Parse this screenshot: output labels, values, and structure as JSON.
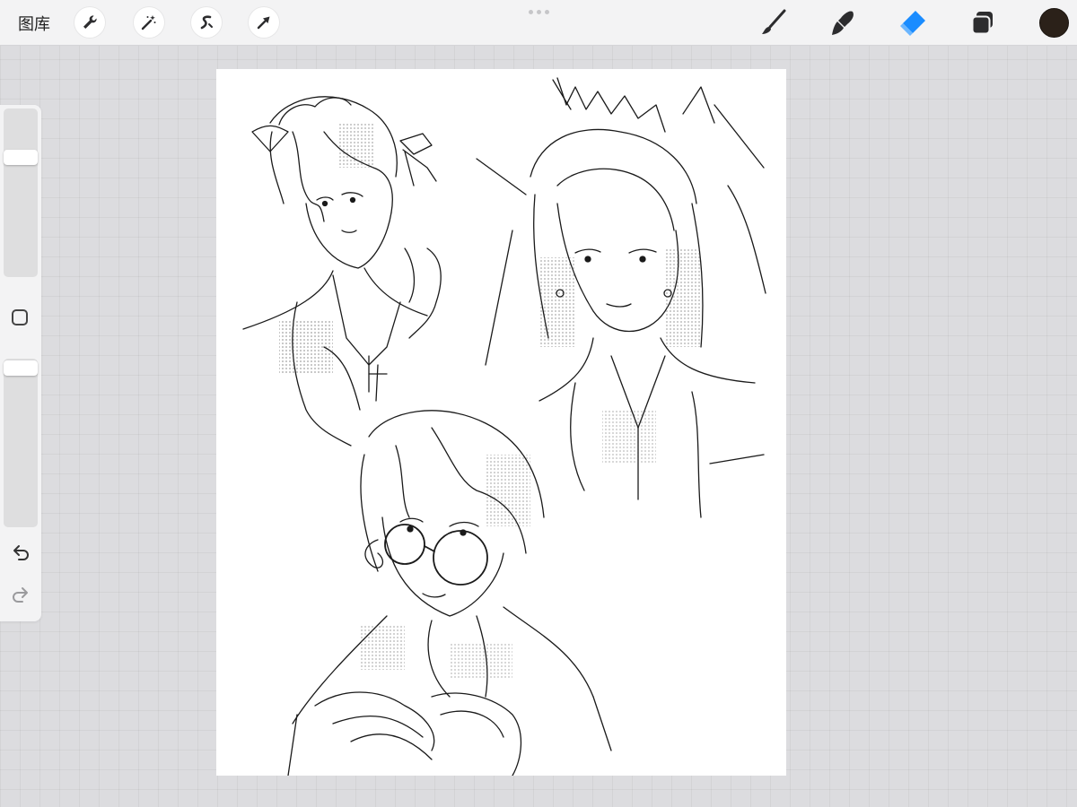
{
  "topbar": {
    "gallery_label": "图库",
    "tools_left": [
      "wrench-icon",
      "magic-wand-icon",
      "selection-icon",
      "transform-arrow-icon"
    ],
    "tools_right": [
      "brush-icon",
      "smudge-icon",
      "eraser-icon",
      "layers-icon",
      "color-swatch"
    ],
    "active_tool": "eraser",
    "accent_color": "#1a8cff",
    "current_color": "#2b2119"
  },
  "sidebar": {
    "brush_size_level": 0.1,
    "opacity_level": 0.03,
    "controls": [
      "brush-size-slider",
      "modify-button",
      "opacity-slider",
      "undo-icon",
      "redo-icon"
    ]
  },
  "canvas": {
    "content": "ink-sketch-artwork",
    "background": "#ffffff"
  }
}
